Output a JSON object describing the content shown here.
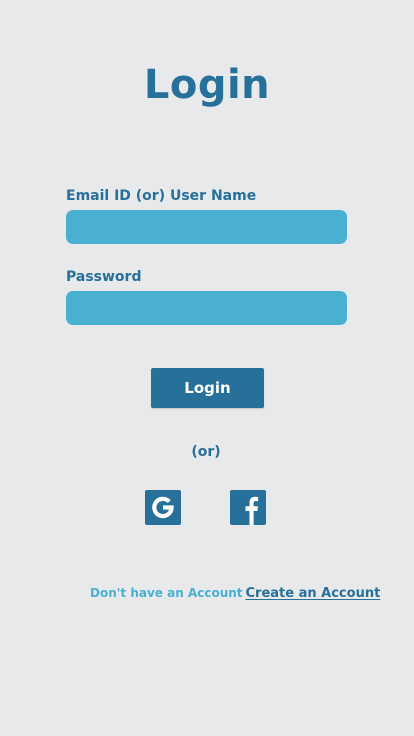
{
  "page": {
    "title": "Login"
  },
  "form": {
    "email_label": "Email ID (or) User Name",
    "email_value": "",
    "password_label": "Password",
    "password_value": "",
    "submit_label": "Login"
  },
  "divider": {
    "text": "(or)"
  },
  "social": {
    "google_icon": "google-icon",
    "facebook_icon": "facebook-icon"
  },
  "footer": {
    "prompt": "Don't have an Account",
    "link_label": "Create an Account"
  },
  "colors": {
    "background": "#e8e9ea",
    "primary": "#27709a",
    "accent": "#4ab0d1"
  }
}
